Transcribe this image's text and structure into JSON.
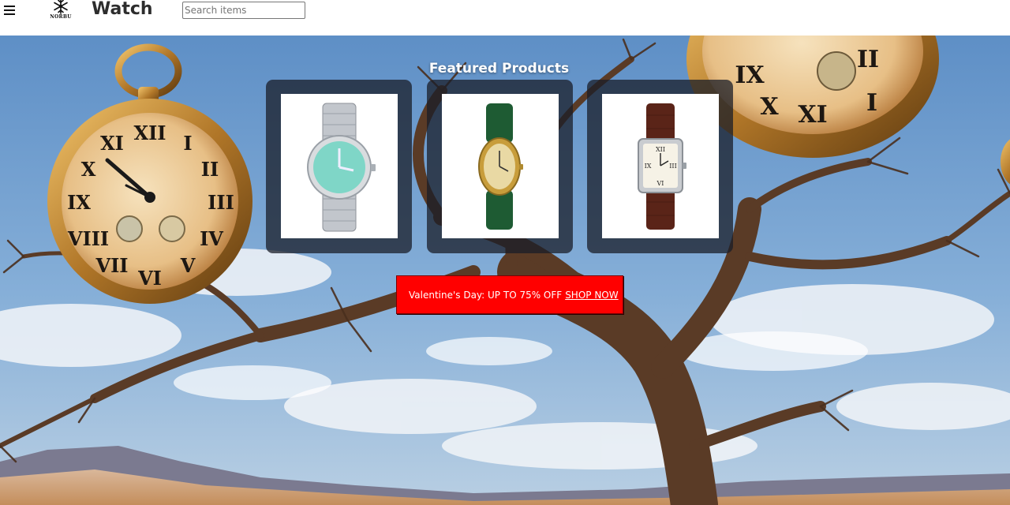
{
  "header": {
    "menu_icon": "hamburger-menu-icon",
    "logo": {
      "icon": "snowflake-logo-icon",
      "text": "NORBU"
    },
    "brand_title": "Watch",
    "search": {
      "placeholder": "Search items",
      "value": ""
    }
  },
  "featured": {
    "title": "Featured Products",
    "products": [
      {
        "image": "silver-watch-mint-dial",
        "strap_color": "#b8bcc2",
        "dial_color": "#7fd6c7"
      },
      {
        "image": "gold-oval-watch-green-strap",
        "strap_color": "#1e5b33",
        "dial_color": "#e9d9a4"
      },
      {
        "image": "square-watch-brown-strap",
        "strap_color": "#5a2418",
        "dial_color": "#f6f2e6"
      }
    ]
  },
  "promo": {
    "text": "Valentine's Day: UP TO 75% OFF",
    "link_label": "SHOP NOW",
    "background": "#ff0000"
  },
  "colors": {
    "sky": "#6f9fd0",
    "card_bg": "rgba(25,30,40,0.75)",
    "title_color": "#ffffff"
  }
}
